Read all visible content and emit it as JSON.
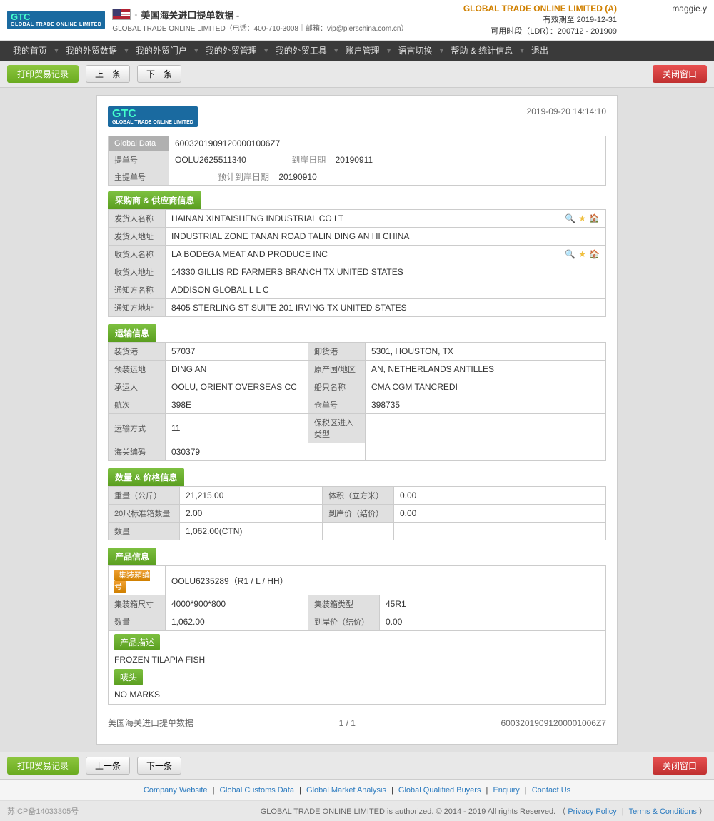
{
  "header": {
    "logo_text": "GTC",
    "logo_sub": "GLOBAL TRADE ONLINE LIMITED",
    "site_title": "美国海关进口提单数据 -",
    "site_contact": "GLOBAL TRADE ONLINE LIMITED（电话：400-710-3008｜邮箱：vip@pierschina.com.cn）",
    "company_badge": "GLOBAL TRADE ONLINE LIMITED (A)",
    "valid_until": "有效期至 2019-12-31",
    "ldr": "可用时段（LDR）：200712 - 201909",
    "user": "maggie.y"
  },
  "nav": {
    "items": [
      "我的首页",
      "我的外贸数据",
      "我的外贸门户",
      "我的外贸管理",
      "我的外贸工具",
      "账户管理",
      "语言切换",
      "帮助 & 统计信息",
      "退出"
    ]
  },
  "toolbar": {
    "print_label": "打印贸易记录",
    "prev_label": "上一条",
    "next_label": "下一条",
    "close_label": "关闭窗口"
  },
  "doc": {
    "datetime": "2019-09-20 14:14:10",
    "global_data_label": "Global Data",
    "global_data_value": "60032019091200001006Z7",
    "bill_no_label": "提单号",
    "bill_no_value": "OOLU2625511340",
    "arrival_date_label": "到岸日期",
    "arrival_date_value": "20190911",
    "master_bill_label": "主提单号",
    "master_bill_value": "",
    "est_arrival_label": "预计到岸日期",
    "est_arrival_value": "20190910"
  },
  "supplier": {
    "section_title": "采购商 & 供应商信息",
    "shipper_name_label": "发货人名称",
    "shipper_name_value": "HAINAN XINTAISHENG INDUSTRIAL CO LT",
    "shipper_addr_label": "发货人地址",
    "shipper_addr_value": "INDUSTRIAL ZONE TANAN ROAD TALIN DING AN HI CHINA",
    "consignee_name_label": "收货人名称",
    "consignee_name_value": "LA BODEGA MEAT AND PRODUCE INC",
    "consignee_addr_label": "收货人地址",
    "consignee_addr_value": "14330 GILLIS RD FARMERS BRANCH TX UNITED STATES",
    "notify_name_label": "通知方名称",
    "notify_name_value": "ADDISON GLOBAL L L C",
    "notify_addr_label": "通知方地址",
    "notify_addr_value": "8405 STERLING ST SUITE 201 IRVING TX UNITED STATES"
  },
  "transport": {
    "section_title": "运输信息",
    "departure_port_label": "装货港",
    "departure_port_value": "57037",
    "arrival_port_label": "卸货港",
    "arrival_port_value": "5301, HOUSTON, TX",
    "loading_place_label": "预装运地",
    "loading_place_value": "DING AN",
    "origin_label": "原产国/地区",
    "origin_value": "AN, NETHERLANDS ANTILLES",
    "carrier_label": "承运人",
    "carrier_value": "OOLU, ORIENT OVERSEAS CC",
    "vessel_label": "船只名称",
    "vessel_value": "CMA CGM TANCREDI",
    "voyage_label": "航次",
    "voyage_value": "398E",
    "warehouse_label": "仓单号",
    "warehouse_value": "398735",
    "transport_mode_label": "运输方式",
    "transport_mode_value": "11",
    "bonded_label": "保税区进入类型",
    "bonded_value": "",
    "customs_code_label": "海关编码",
    "customs_code_value": "030379"
  },
  "quantity": {
    "section_title": "数量 & 价格信息",
    "weight_label": "重量（公斤）",
    "weight_value": "21,215.00",
    "volume_label": "体积（立方米）",
    "volume_value": "0.00",
    "container20_label": "20尺标准箱数量",
    "container20_value": "2.00",
    "arrival_price_label": "到岸价（结价）",
    "arrival_price_value": "0.00",
    "quantity_label": "数量",
    "quantity_value": "1,062.00(CTN)"
  },
  "product": {
    "section_title": "产品信息",
    "container_no_label": "集装箱编号",
    "container_no_value": "OOLU6235289（R1 / L / HH）",
    "container_size_label": "集装箱尺寸",
    "container_size_value": "4000*900*800",
    "container_type_label": "集装箱类型",
    "container_type_value": "45R1",
    "quantity_label": "数量",
    "quantity_value": "1,062.00",
    "price_label": "到岸价（结价）",
    "price_value": "0.00",
    "desc_title": "产品描述",
    "desc_value": "FROZEN TILAPIA FISH",
    "marks_title": "唛头",
    "marks_value": "NO MARKS"
  },
  "pagination": {
    "source": "美国海关进口提单数据",
    "page": "1 / 1",
    "doc_id": "60032019091200001006Z7"
  },
  "footer": {
    "links": [
      "Company Website",
      "Global Customs Data",
      "Global Market Analysis",
      "Global Qualified Buyers",
      "Enquiry",
      "Contact Us"
    ],
    "copyright": "GLOBAL TRADE ONLINE LIMITED is authorized. © 2014 - 2019 All rights Reserved.  （",
    "privacy": "Privacy Policy",
    "separator": "|",
    "terms": "Terms & Conditions",
    "copyright_end": "）",
    "beian": "苏ICP备14033305号"
  }
}
